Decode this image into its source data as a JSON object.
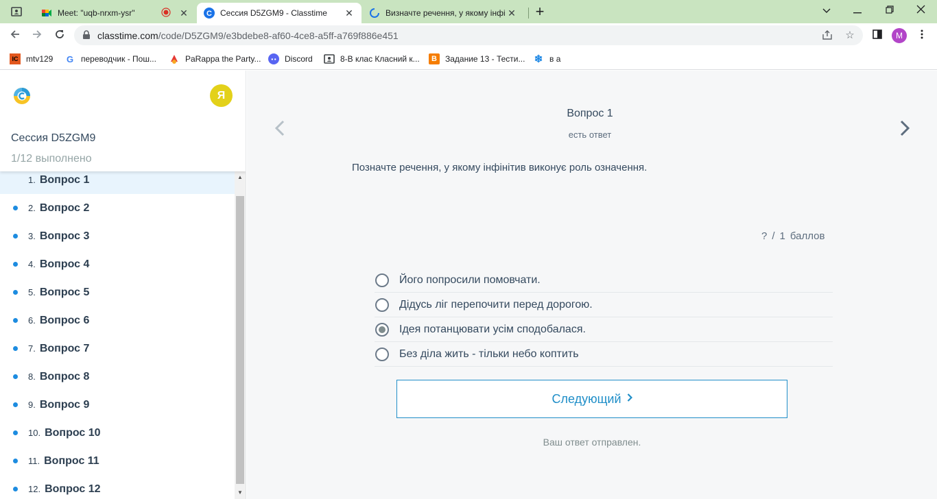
{
  "browser": {
    "tabs": [
      {
        "title": "Meet: \"uqb-nrxm-ysr\"",
        "icon": "google-meet-icon"
      },
      {
        "title": "Сессия D5ZGM9 - Classtime",
        "icon": "classtime-icon",
        "active": true
      },
      {
        "title": "Визначте речення, у якому інфі",
        "icon": "loading-spinner-icon"
      }
    ],
    "url_host": "classtime.com",
    "url_path": "/code/D5ZGM9/e3bdebe8-af60-4ce8-a5ff-a769f886e451",
    "profile_initial": "M",
    "bookmarks": [
      {
        "label": "mtv129",
        "icon": "mtv-icon"
      },
      {
        "label": "переводчик - Пош...",
        "icon": "google-icon"
      },
      {
        "label": "PaRappa the Party...",
        "icon": "parappa-icon"
      },
      {
        "label": "Discord",
        "icon": "discord-icon"
      },
      {
        "label": "8-В клас Класний к...",
        "icon": "classroom-icon"
      },
      {
        "label": "Задание 13 - Тести...",
        "icon": "blogger-icon"
      },
      {
        "label": "в а",
        "icon": "snowflake-icon"
      }
    ]
  },
  "sidebar": {
    "user_initial": "Я",
    "session_title": "Сессия D5ZGM9",
    "progress": "1/12 выполнено",
    "questions": [
      {
        "num": "1.",
        "label": "Вопрос 1"
      },
      {
        "num": "2.",
        "label": "Вопрос 2"
      },
      {
        "num": "3.",
        "label": "Вопрос 3"
      },
      {
        "num": "4.",
        "label": "Вопрос 4"
      },
      {
        "num": "5.",
        "label": "Вопрос 5"
      },
      {
        "num": "6.",
        "label": "Вопрос 6"
      },
      {
        "num": "7.",
        "label": "Вопрос 7"
      },
      {
        "num": "8.",
        "label": "Вопрос 8"
      },
      {
        "num": "9.",
        "label": "Вопрос 9"
      },
      {
        "num": "10.",
        "label": "Вопрос 10"
      },
      {
        "num": "11.",
        "label": "Вопрос 11"
      },
      {
        "num": "12.",
        "label": "Вопрос 12"
      }
    ]
  },
  "main": {
    "question_heading": "Вопрос 1",
    "question_status": "есть ответ",
    "question_text": "Позначте речення, у якому інфінітив виконує роль означення.",
    "score": {
      "earned": "?",
      "sep": "/",
      "total": "1",
      "unit": "баллов"
    },
    "options": [
      {
        "text": "Його попросили помовчати.",
        "checked": false
      },
      {
        "text": "Дідусь ліг перепочити перед дорогою.",
        "checked": false
      },
      {
        "text": "Ідея потанцювати усім сподобалася.",
        "checked": true
      },
      {
        "text": "Без діла жить - тільки небо коптить",
        "checked": false
      }
    ],
    "next_button": "Следующий",
    "sent_message": "Ваш ответ отправлен."
  },
  "colors": {
    "tabstrip": "#c9e4c0",
    "accent": "#1f8ec8",
    "avatar_user": "#e3d11a",
    "avatar_profile": "#b245c8"
  }
}
